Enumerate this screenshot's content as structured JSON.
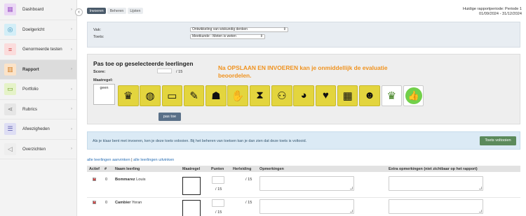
{
  "sidebar": {
    "items": [
      {
        "label": "Dashboard",
        "icon": "grid-icon",
        "color": "#b57edc"
      },
      {
        "label": "Doelgericht",
        "icon": "target-icon",
        "color": "#7ec8e3"
      },
      {
        "label": "Genormeerde testen",
        "icon": "lines-icon",
        "color": "#f08080"
      },
      {
        "label": "Rapport",
        "icon": "chart-icon",
        "color": "#f4a460"
      },
      {
        "label": "Portfolio",
        "icon": "folder-icon",
        "color": "#9acd32"
      },
      {
        "label": "Rubrics",
        "icon": "share-icon",
        "color": "#aaaaaa"
      },
      {
        "label": "Afwezigheden",
        "icon": "list-icon",
        "color": "#9090d0"
      },
      {
        "label": "Overzichten",
        "icon": "megaphone-icon",
        "color": "#bbbbbb"
      }
    ],
    "active_index": 3
  },
  "tabs": [
    "Invoeren",
    "Beheren",
    "Lijsten"
  ],
  "period": {
    "line1": "Huidige rapportperiode: Periode 1",
    "line2": "01/09/2024 - 31/12/2024"
  },
  "filter": {
    "vak_label": "Vak:",
    "vak_value": "Ontwikkeling van wiskundig denken",
    "toets_label": "Toets:",
    "toets_value": "Meetkunde - Meten is weten"
  },
  "apply": {
    "title": "Pas toe op geselecteerde leerlingen",
    "note": "Na OPSLAAN EN INVOEREN kan je onmiddellijk de evaluatie beoordelen.",
    "score_label": "Score:",
    "score_max": "/ 15",
    "maatregel_label": "Maatregel:",
    "geen": "geen",
    "icons": [
      "♛",
      "🌍",
      "🖥",
      "✎",
      "🗣",
      "✋",
      "⧗",
      "👥",
      "◕",
      "♥",
      "▦",
      "👤",
      "♛",
      "👍"
    ],
    "button": "pas toe"
  },
  "info": {
    "text": "Als je klaar bent met invoeren, ken je deze toets volooien. Bij het beheren van toetsen kan je dan zien dat deze toets is voltooid.",
    "button": "Toets voltooien"
  },
  "links": {
    "select_all": "alle leerlingen aanvinken",
    "separator": " | ",
    "deselect_all": "alle leerlingen uitvinken"
  },
  "table": {
    "headers": [
      "Actief",
      "#",
      "Naam leerling",
      "Maatregel",
      "Punten",
      "Herleiding",
      "Opmerkingen",
      "Extra opmerkingen (niet zichtbaar op het rapport)"
    ],
    "rows": [
      {
        "nr": "0",
        "lastname": "Bommarez",
        "firstname": "Louis",
        "max": "/ 15",
        "herleiding": "/ 15"
      },
      {
        "nr": "0",
        "lastname": "Cambier",
        "firstname": "Yoran",
        "max": "/ 15",
        "herleiding": "/ 15"
      }
    ]
  }
}
